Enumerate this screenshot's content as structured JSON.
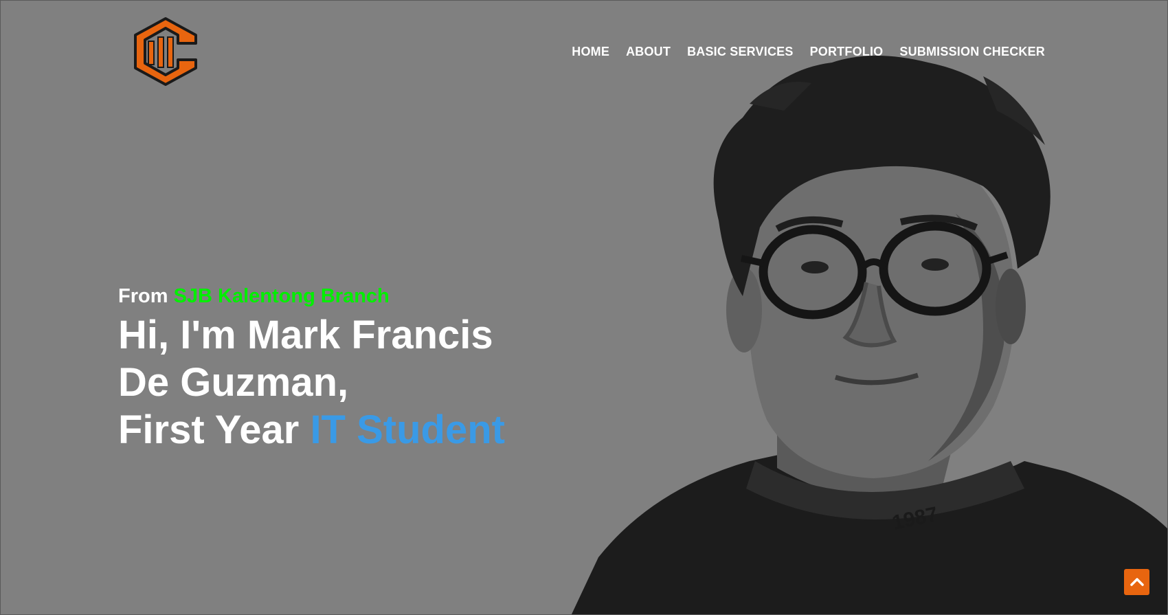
{
  "nav": {
    "items": [
      {
        "label": "HOME"
      },
      {
        "label": "ABOUT"
      },
      {
        "label": "BASIC SERVICES"
      },
      {
        "label": "PORTFOLIO"
      },
      {
        "label": "SUBMISSION CHECKER"
      }
    ]
  },
  "hero": {
    "from_prefix": "From ",
    "branch": "SJB Kalentong Branch",
    "line1": "Hi, I'm Mark Francis",
    "line2": "De Guzman,",
    "line3_prefix": "First Year ",
    "role": "IT Student"
  },
  "icons": {
    "logo": "hexagon-c-logo",
    "scroll_top": "chevron-up-icon"
  },
  "colors": {
    "background": "#808080",
    "accent_orange": "#e8650f",
    "branch_green": "#00f000",
    "role_blue": "#3a9ae6",
    "text": "#ffffff"
  }
}
